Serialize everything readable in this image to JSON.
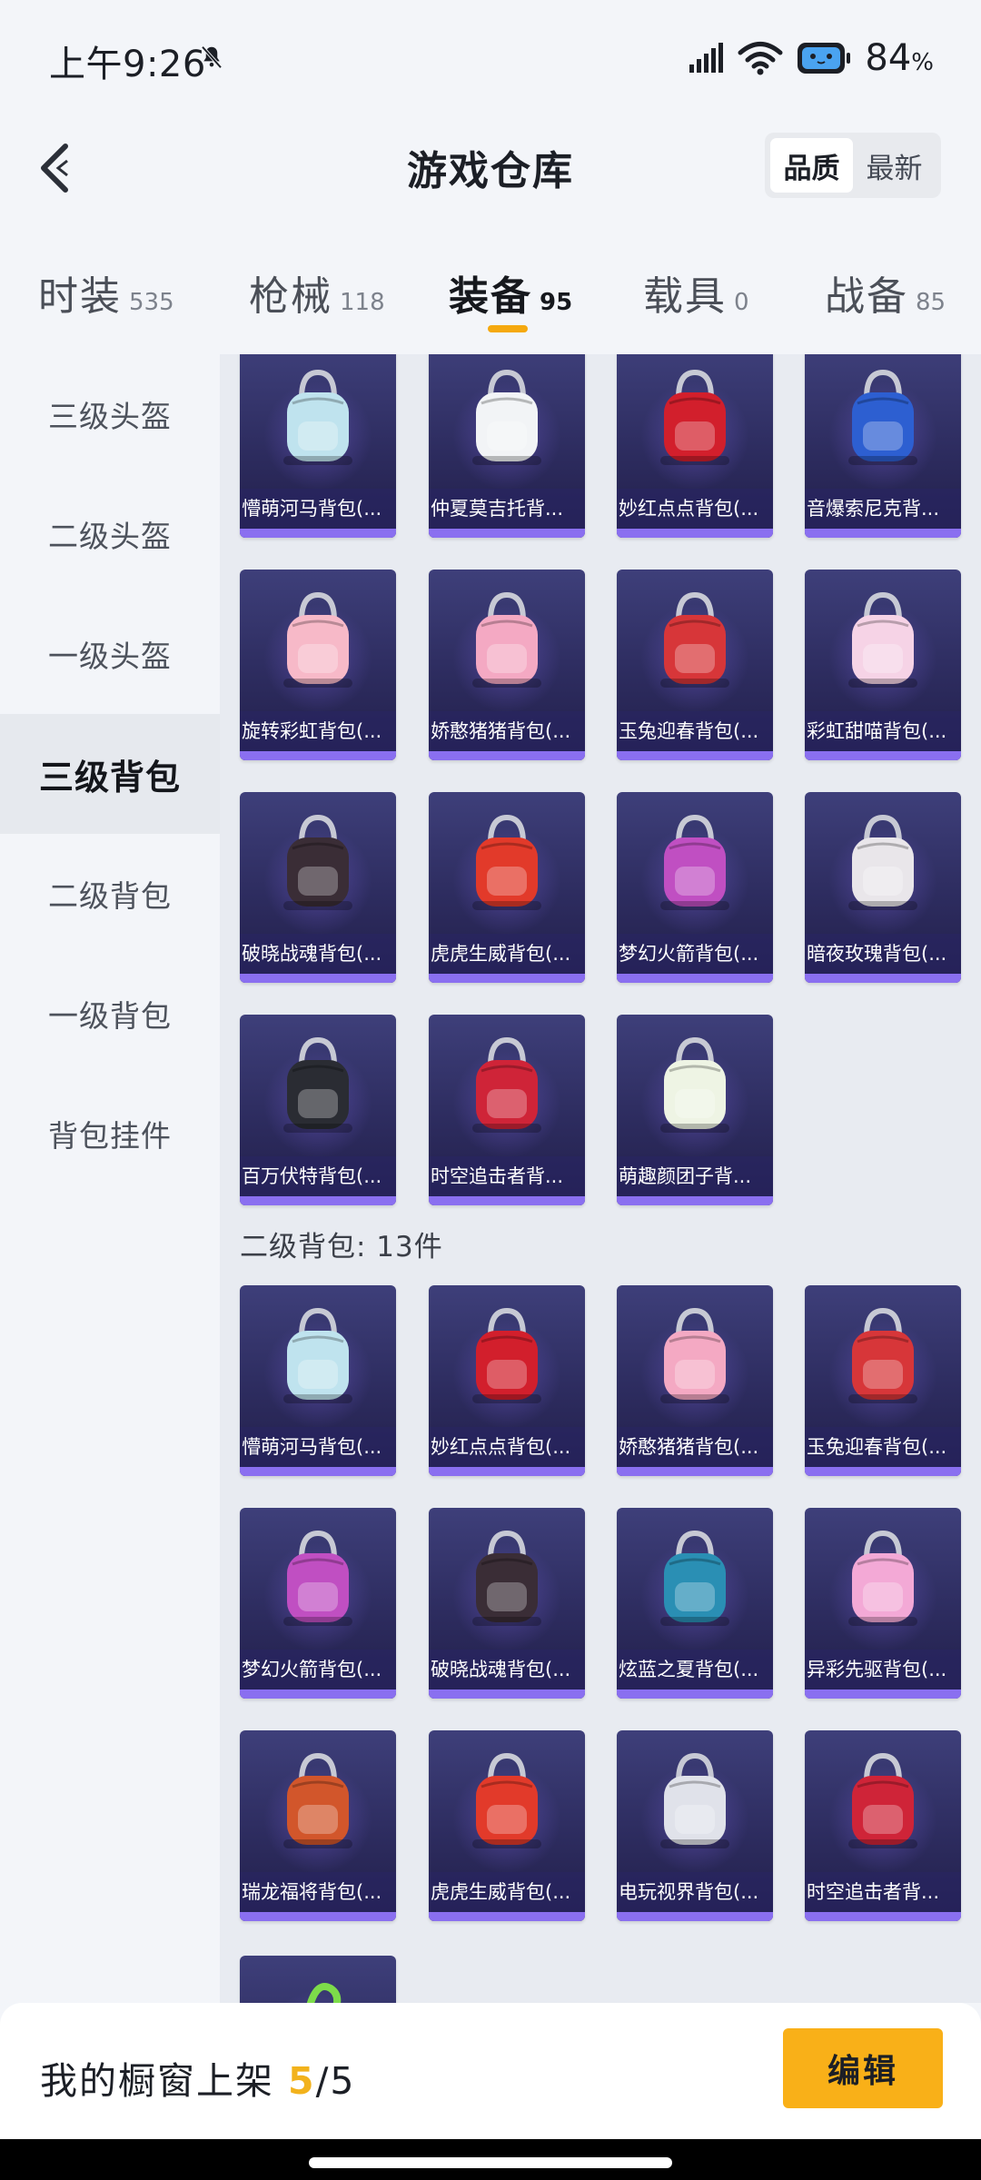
{
  "status": {
    "time": "上午9:26",
    "battery_value": "84",
    "battery_unit": "%"
  },
  "header": {
    "title": "游戏仓库",
    "sort_options": [
      "品质",
      "最新"
    ],
    "sort_active": "品质"
  },
  "tabs": [
    {
      "label": "时装",
      "count": "535"
    },
    {
      "label": "枪械",
      "count": "118"
    },
    {
      "label": "装备",
      "count": "95"
    },
    {
      "label": "载具",
      "count": "0"
    },
    {
      "label": "战备",
      "count": "85"
    }
  ],
  "active_tab": "装备",
  "sidebar": {
    "items": [
      "三级头盔",
      "二级头盔",
      "一级头盔",
      "三级背包",
      "二级背包",
      "一级背包",
      "背包挂件"
    ],
    "active": "三级背包"
  },
  "level3_items": [
    {
      "name": "懵萌河马背包(...",
      "color": "#bfe3ee"
    },
    {
      "name": "仲夏莫吉托背...",
      "color": "#f2f4f6"
    },
    {
      "name": "妙红点点背包(...",
      "color": "#d21f2c"
    },
    {
      "name": "音爆索尼克背...",
      "color": "#2d5fd1"
    },
    {
      "name": "旋转彩虹背包(...",
      "color": "#f7b9c8"
    },
    {
      "name": "娇憨猪猪背包(...",
      "color": "#f4a9c3"
    },
    {
      "name": "玉兔迎春背包(...",
      "color": "#d73639"
    },
    {
      "name": "彩虹甜喵背包(...",
      "color": "#f6d3e6"
    },
    {
      "name": "破晓战魂背包(...",
      "color": "#3a2d36"
    },
    {
      "name": "虎虎生威背包(...",
      "color": "#e23a2a"
    },
    {
      "name": "梦幻火箭背包(...",
      "color": "#c04fc2"
    },
    {
      "name": "暗夜玫瑰背包(...",
      "color": "#e9e6ea"
    },
    {
      "name": "百万伏特背包(...",
      "color": "#2a2c33"
    },
    {
      "name": "时空追击者背...",
      "color": "#cf2438"
    },
    {
      "name": "萌趣颜团子背...",
      "color": "#eef4e4"
    }
  ],
  "level2_header": "二级背包: 13件",
  "level2_items": [
    {
      "name": "懵萌河马背包(...",
      "color": "#bfe3ee"
    },
    {
      "name": "妙红点点背包(...",
      "color": "#d21f2c"
    },
    {
      "name": "娇憨猪猪背包(...",
      "color": "#f4a9c3"
    },
    {
      "name": "玉兔迎春背包(...",
      "color": "#d73639"
    },
    {
      "name": "梦幻火箭背包(...",
      "color": "#c04fc2"
    },
    {
      "name": "破晓战魂背包(...",
      "color": "#3a2d36"
    },
    {
      "name": "炫蓝之夏背包(...",
      "color": "#2a8fb4"
    },
    {
      "name": "异彩先驱背包(...",
      "color": "#f3a9d6"
    },
    {
      "name": "瑞龙福将背包(...",
      "color": "#d2562b"
    },
    {
      "name": "虎虎生威背包(...",
      "color": "#e23a2a"
    },
    {
      "name": "电玩视界背包(...",
      "color": "#e0e2ea"
    },
    {
      "name": "时空追击者背...",
      "color": "#cf2438"
    }
  ],
  "bottom": {
    "label": "我的橱窗上架",
    "current": "5",
    "total": "/5",
    "edit_label": "编辑"
  }
}
